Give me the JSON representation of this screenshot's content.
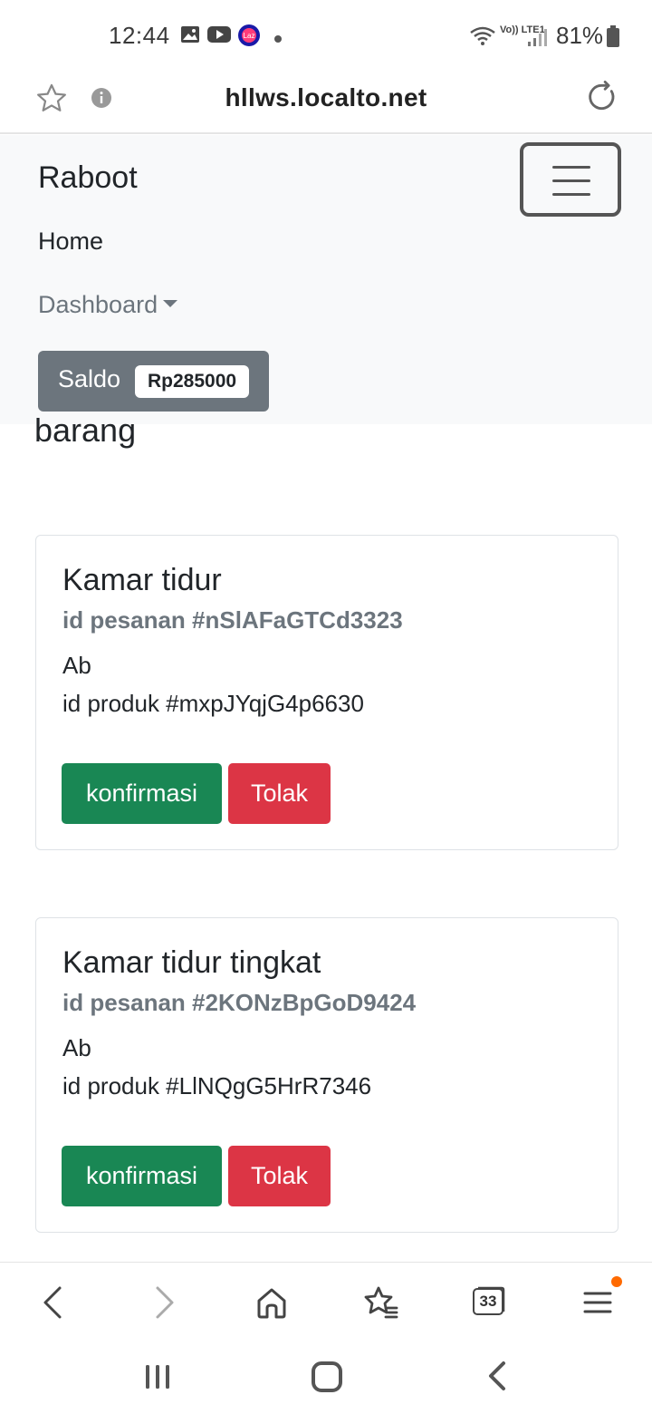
{
  "status_bar": {
    "time": "12:44",
    "network_label": "Vo)) LTE1",
    "battery": "81%",
    "icons": [
      "gallery-icon",
      "youtube-icon",
      "lazada-icon",
      "dot-icon",
      "wifi-icon",
      "signal-icon",
      "battery-icon"
    ]
  },
  "browser": {
    "url": "hllws.localto.net",
    "tab_count": "33",
    "toolbar_icons": [
      "back-icon",
      "forward-icon",
      "home-icon",
      "bookmarks-icon",
      "tabs-icon",
      "menu-icon"
    ]
  },
  "navbar": {
    "brand": "Raboot",
    "home": "Home",
    "dashboard": "Dashboard",
    "saldo_label": "Saldo",
    "saldo_value": "Rp285000"
  },
  "page": {
    "heading": "barang"
  },
  "orders": [
    {
      "title": "Kamar tidur",
      "order_id": "id pesanan #nSlAFaGTCd3323",
      "text": "Ab",
      "product_id": "id produk #mxpJYqjG4p6630",
      "confirm_label": "konfirmasi",
      "reject_label": "Tolak"
    },
    {
      "title": "Kamar tidur tingkat",
      "order_id": "id pesanan #2KONzBpGoD9424",
      "text": "Ab",
      "product_id": "id produk #LlNQgG5HrR7346",
      "confirm_label": "konfirmasi",
      "reject_label": "Tolak"
    }
  ],
  "colors": {
    "success": "#198754",
    "danger": "#dc3545",
    "secondary": "#6c757d",
    "navbar_bg": "#f8f9fa"
  }
}
